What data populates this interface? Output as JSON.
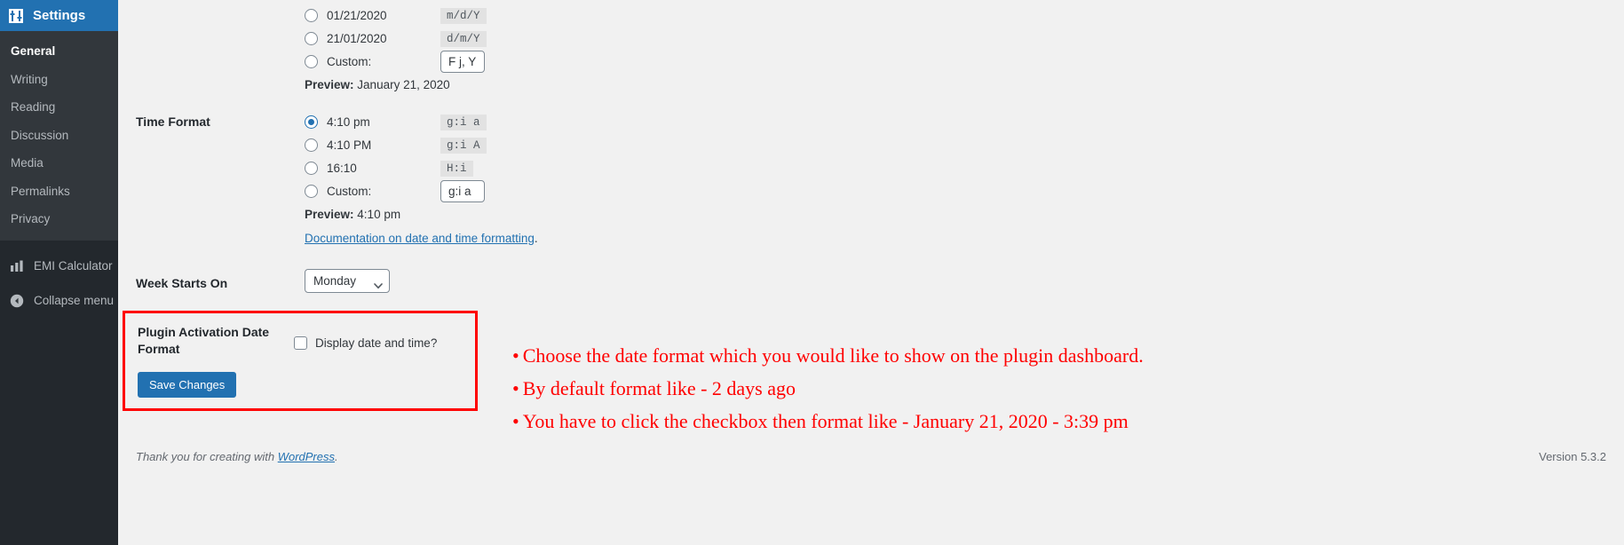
{
  "sidebar": {
    "header": {
      "label": "Settings",
      "icon": "sliders-icon"
    },
    "submenu": [
      {
        "label": "General",
        "current": true
      },
      {
        "label": "Writing",
        "current": false
      },
      {
        "label": "Reading",
        "current": false
      },
      {
        "label": "Discussion",
        "current": false
      },
      {
        "label": "Media",
        "current": false
      },
      {
        "label": "Permalinks",
        "current": false
      },
      {
        "label": "Privacy",
        "current": false
      }
    ],
    "plugin_item": {
      "label": "EMI Calculator",
      "icon": "bar-chart-icon"
    },
    "collapse_item": {
      "label": "Collapse menu",
      "icon": "collapse-arrow-icon"
    }
  },
  "date_format": {
    "options": [
      {
        "text": "01/21/2020",
        "code": "m/d/Y",
        "checked": false
      },
      {
        "text": "21/01/2020",
        "code": "d/m/Y",
        "checked": false
      },
      {
        "text": "Custom:",
        "code": "",
        "checked": false
      }
    ],
    "custom_value": "F j, Y",
    "preview_label": "Preview:",
    "preview_value": "January 21, 2020"
  },
  "time_format": {
    "label": "Time Format",
    "options": [
      {
        "text": "4:10 pm",
        "code": "g:i a",
        "checked": true
      },
      {
        "text": "4:10 PM",
        "code": "g:i A",
        "checked": false
      },
      {
        "text": "16:10",
        "code": "H:i",
        "checked": false
      },
      {
        "text": "Custom:",
        "code": "",
        "checked": false
      }
    ],
    "custom_value": "g:i a",
    "preview_label": "Preview:",
    "preview_value": "4:10 pm",
    "doc_link": "Documentation on date and time formatting",
    "doc_suffix": "."
  },
  "week_starts_on": {
    "label": "Week Starts On",
    "selected": "Monday"
  },
  "plugin_section": {
    "label": "Plugin Activation Date Format",
    "checkbox_label": "Display date and time?",
    "checkbox_checked": false,
    "save_label": "Save Changes",
    "highlight_color": "#ff0000"
  },
  "annotations": {
    "color": "#ff0000",
    "lines": [
      "Choose the date format which you would like to show on the plugin dashboard.",
      "By default format like - 2 days ago",
      "You have to click the checkbox then format like - January 21, 2020 - 3:39 pm"
    ]
  },
  "footer": {
    "thanks_prefix": "Thank you for creating with ",
    "wordpress_link": "WordPress",
    "thanks_suffix": ".",
    "version": "Version 5.3.2"
  }
}
